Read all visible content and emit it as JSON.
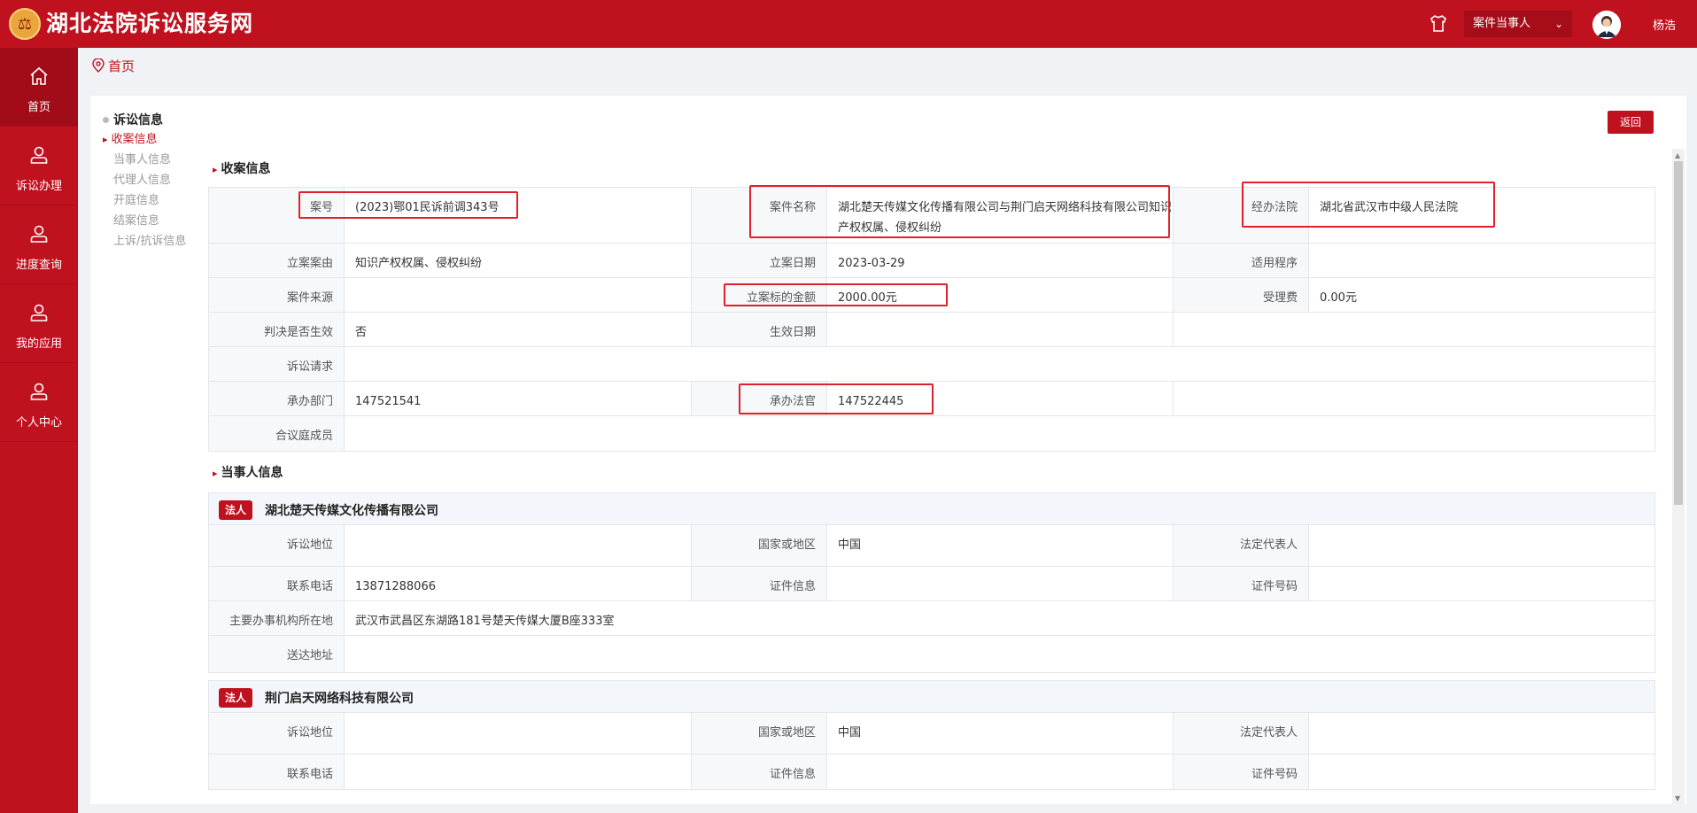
{
  "header": {
    "title": "湖北法院诉讼服务网",
    "logo_icon": "court-emblem-icon",
    "role_select": "案件当事人",
    "user_name": "杨浩"
  },
  "sidebar": [
    {
      "label": "首页",
      "icon": "home-icon",
      "active": true
    },
    {
      "label": "诉讼办理",
      "icon": "user-icon"
    },
    {
      "label": "进度查询",
      "icon": "user-icon"
    },
    {
      "label": "我的应用",
      "icon": "user-icon"
    },
    {
      "label": "个人中心",
      "icon": "user-icon"
    }
  ],
  "breadcrumb": "首页",
  "left_nav": {
    "head": "诉讼信息",
    "items": [
      "收案信息",
      "当事人信息",
      "代理人信息",
      "开庭信息",
      "结案信息",
      "上诉/抗诉信息"
    ]
  },
  "return_label": "返回",
  "case_section": {
    "title": "收案信息",
    "rows": [
      [
        "案号",
        "(2023)鄂01民诉前调343号",
        "案件名称",
        "湖北楚天传媒文化传播有限公司与荆门启天网络科技有限公司知识产权权属、侵权纠纷",
        "经办法院",
        "湖北省武汉市中级人民法院"
      ],
      [
        "立案案由",
        "知识产权权属、侵权纠纷",
        "立案日期",
        "2023-03-29",
        "适用程序",
        ""
      ],
      [
        "案件来源",
        "",
        "立案标的金额",
        "2000.00元",
        "受理费",
        "0.00元"
      ],
      [
        "判决是否生效",
        "否",
        "生效日期",
        "",
        "",
        ""
      ],
      [
        "诉讼请求",
        ""
      ],
      [
        "承办部门",
        "147521541",
        "承办法官",
        "147522445",
        "",
        ""
      ],
      [
        "合议庭成员",
        ""
      ]
    ]
  },
  "party_section": {
    "title": "当事人信息",
    "parties": [
      {
        "badge": "法人",
        "name": "湖北楚天传媒文化传播有限公司",
        "rows": [
          [
            "诉讼地位",
            "",
            "国家或地区",
            "中国",
            "法定代表人",
            ""
          ],
          [
            "联系电话",
            "13871288066",
            "证件信息",
            "",
            "证件号码",
            ""
          ],
          [
            "主要办事机构所在地",
            "武汉市武昌区东湖路181号楚天传媒大厦B座333室"
          ],
          [
            "送达地址",
            ""
          ]
        ]
      },
      {
        "badge": "法人",
        "name": "荆门启天网络科技有限公司",
        "rows": [
          [
            "诉讼地位",
            "",
            "国家或地区",
            "中国",
            "法定代表人",
            ""
          ],
          [
            "联系电话",
            "",
            "证件信息",
            "",
            "证件号码",
            ""
          ]
        ]
      }
    ]
  },
  "colors": {
    "brand": "#c0111f",
    "highlight": "#e0202a"
  }
}
